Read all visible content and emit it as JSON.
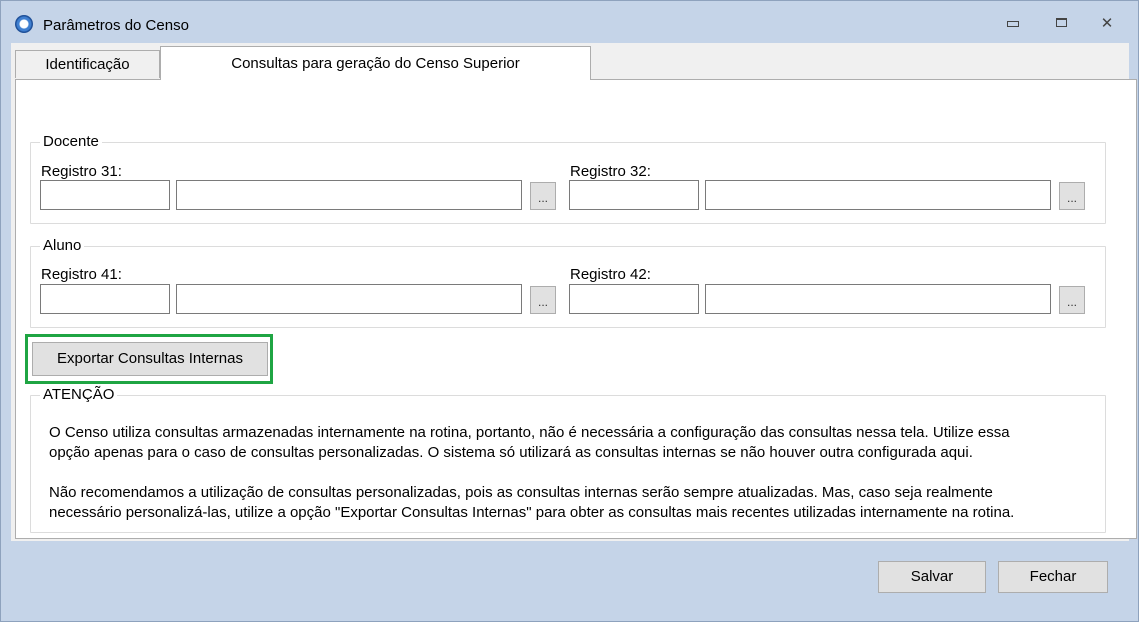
{
  "window": {
    "title": "Parâmetros do Censo",
    "icons": {
      "app": "app-icon",
      "minimize": "minimize-icon",
      "maximize": "maximize-icon",
      "close": "close-icon"
    }
  },
  "tabs": [
    {
      "label": "Identificação",
      "active": false
    },
    {
      "label": "Consultas para geração do Censo Superior",
      "active": true
    }
  ],
  "docente": {
    "legend": "Docente",
    "reg31": {
      "label": "Registro 31:",
      "code_value": "",
      "desc_value": "",
      "browse_label": "..."
    },
    "reg32": {
      "label": "Registro 32:",
      "code_value": "",
      "desc_value": "",
      "browse_label": "..."
    }
  },
  "aluno": {
    "legend": "Aluno",
    "reg41": {
      "label": "Registro 41:",
      "code_value": "",
      "desc_value": "",
      "browse_label": "..."
    },
    "reg42": {
      "label": "Registro 42:",
      "code_value": "",
      "desc_value": "",
      "browse_label": "..."
    }
  },
  "export_button": {
    "label": "Exportar Consultas Internas",
    "highlight_color": "#1fa543"
  },
  "attention": {
    "legend": "ATENÇÃO",
    "line1": "O Censo utiliza consultas armazenadas internamente na rotina, portanto, não é necessária a configuração das consultas nessa tela. Utilize essa",
    "line2": "opção apenas para o caso de consultas personalizadas. O sistema só utilizará as consultas internas se não houver outra configurada aqui.",
    "line3": "Não recomendamos a utilização de consultas personalizadas, pois as consultas internas serão sempre atualizadas. Mas, caso seja realmente",
    "line4": "necessário personalizá-las, utilize a opção \"Exportar Consultas Internas\" para obter as consultas mais recentes utilizadas internamente na rotina."
  },
  "footer": {
    "save_label": "Salvar",
    "close_label": "Fechar"
  }
}
